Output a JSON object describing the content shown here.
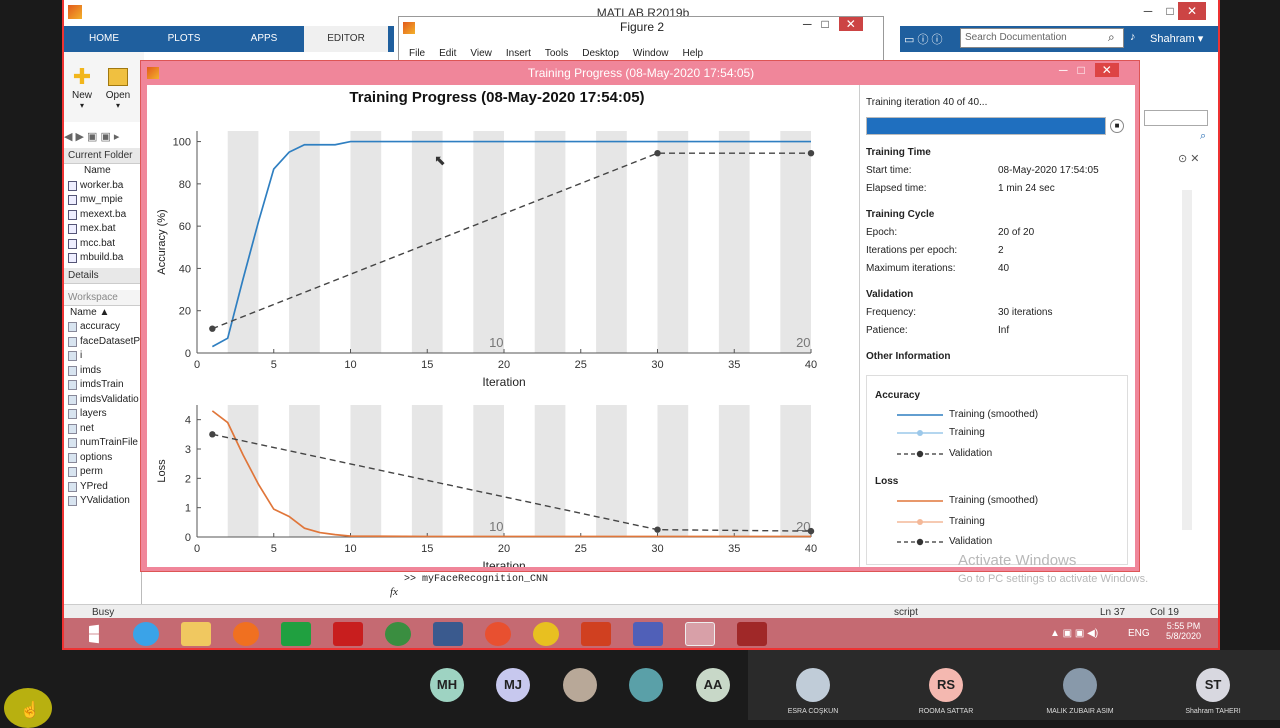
{
  "matlab": {
    "title": "MATLAB R2019b",
    "tabs": [
      "HOME",
      "PLOTS",
      "APPS",
      "EDITOR"
    ],
    "active_tab": "EDITOR",
    "tool_new": "New",
    "tool_open": "Open",
    "search_placeholder": "Search Documentation",
    "user": "Shahram",
    "current_folder_header": "Current Folder",
    "name_col": "Name",
    "files": [
      "worker.ba",
      "mw_mpie",
      "mexext.ba",
      "mex.bat",
      "mcc.bat",
      "mbuild.ba"
    ],
    "details_header": "Details",
    "workspace_header": "Workspace",
    "workspace_items": [
      "accuracy",
      "faceDatasetP",
      "i",
      "imds",
      "imdsTrain",
      "imdsValidatio",
      "layers",
      "net",
      "numTrainFile",
      "options",
      "perm",
      "YPred",
      "YValidation"
    ],
    "command": ">>  myFaceRecognition_CNN",
    "fx": "fx",
    "status_busy": "Busy",
    "status_script": "script",
    "status_ln": "Ln  37",
    "status_col": "Col  19"
  },
  "figure2": {
    "title": "Figure 2",
    "menu": [
      "File",
      "Edit",
      "View",
      "Insert",
      "Tools",
      "Desktop",
      "Window",
      "Help"
    ]
  },
  "training": {
    "window_title": "Training Progress (08-May-2020 17:54:05)",
    "plot_title": "Training Progress (08-May-2020 17:54:05)",
    "iteration_text": "Training iteration 40 of 40...",
    "progress": 1.0,
    "sections": {
      "time": {
        "header": "Training Time",
        "start_k": "Start time:",
        "start_v": "08-May-2020 17:54:05",
        "elapsed_k": "Elapsed time:",
        "elapsed_v": "1 min 24 sec"
      },
      "cycle": {
        "header": "Training Cycle",
        "epoch_k": "Epoch:",
        "epoch_v": "20 of 20",
        "ipe_k": "Iterations per epoch:",
        "ipe_v": "2",
        "max_k": "Maximum iterations:",
        "max_v": "40"
      },
      "validation": {
        "header": "Validation",
        "freq_k": "Frequency:",
        "freq_v": "30 iterations",
        "pat_k": "Patience:",
        "pat_v": "Inf"
      },
      "other": {
        "header": "Other Information"
      }
    },
    "legend": {
      "acc_header": "Accuracy",
      "loss_header": "Loss",
      "smoothed": "Training (smoothed)",
      "training": "Training",
      "validation": "Validation"
    }
  },
  "chart_data": [
    {
      "type": "line",
      "title": "Training Progress (08-May-2020 17:54:05)",
      "xlabel": "Iteration",
      "ylabel": "Accuracy (%)",
      "xlim": [
        0,
        40
      ],
      "ylim": [
        0,
        105
      ],
      "xticks": [
        0,
        5,
        10,
        15,
        20,
        25,
        30,
        35,
        40
      ],
      "yticks": [
        0,
        20,
        40,
        60,
        80,
        100
      ],
      "epoch_labels": [
        {
          "x": 19.5,
          "label": "10"
        },
        {
          "x": 39.5,
          "label": "20"
        }
      ],
      "series": [
        {
          "name": "Training (smoothed)",
          "color": "#2f7fc1",
          "x": [
            1,
            2,
            3,
            4,
            5,
            6,
            7,
            8,
            9,
            10,
            12,
            15,
            20,
            25,
            30,
            35,
            40
          ],
          "y": [
            3,
            7,
            35,
            62,
            87,
            95,
            98.5,
            98.5,
            98.5,
            100,
            100,
            100,
            100,
            100,
            100,
            100,
            100
          ]
        },
        {
          "name": "Validation",
          "color": "#444444",
          "dashed": true,
          "x": [
            1,
            30,
            40
          ],
          "y": [
            11.5,
            94.5,
            94.5
          ]
        }
      ]
    },
    {
      "type": "line",
      "xlabel": "Iteration",
      "ylabel": "Loss",
      "xlim": [
        0,
        40
      ],
      "ylim": [
        0,
        4.5
      ],
      "xticks": [
        0,
        5,
        10,
        15,
        20,
        25,
        30,
        35,
        40
      ],
      "yticks": [
        0,
        1,
        2,
        3,
        4
      ],
      "epoch_labels": [
        {
          "x": 19.5,
          "label": "10"
        },
        {
          "x": 39.5,
          "label": "20"
        }
      ],
      "series": [
        {
          "name": "Training (smoothed)",
          "color": "#e0763a",
          "x": [
            1,
            2,
            3,
            4,
            5,
            6,
            7,
            8,
            9,
            10,
            15,
            20,
            30,
            40
          ],
          "y": [
            4.3,
            3.9,
            2.8,
            1.8,
            0.95,
            0.7,
            0.3,
            0.15,
            0.08,
            0.03,
            0.02,
            0.02,
            0.02,
            0.02
          ]
        },
        {
          "name": "Validation",
          "color": "#444444",
          "dashed": true,
          "x": [
            1,
            30,
            40
          ],
          "y": [
            3.5,
            0.25,
            0.2
          ]
        }
      ]
    }
  ],
  "os": {
    "watermark1": "Activate Windows",
    "watermark2": "Go to PC settings to activate Windows.",
    "lang": "ENG",
    "time": "5:55 PM",
    "date": "5/8/2020"
  },
  "participants": [
    {
      "initials": "MH",
      "color": "#9ed3c2"
    },
    {
      "initials": "MJ",
      "color": "#c7c8ee"
    },
    {
      "initials": "",
      "color": "#b8a898"
    },
    {
      "initials": "",
      "color": "#5aa0a8"
    },
    {
      "initials": "AA",
      "color": "#c8d8c8"
    },
    {
      "initials": "",
      "color": "#c0ccd8",
      "name": "ESRA COŞKUN"
    },
    {
      "initials": "RS",
      "color": "#f4b8b0",
      "name": "ROOMA SATTAR"
    },
    {
      "initials": "",
      "color": "#8899aa",
      "name": "MALIK ZUBAIR ASIM"
    },
    {
      "initials": "ST",
      "color": "#d8d8e0",
      "name": "Shahram TAHERI"
    }
  ]
}
